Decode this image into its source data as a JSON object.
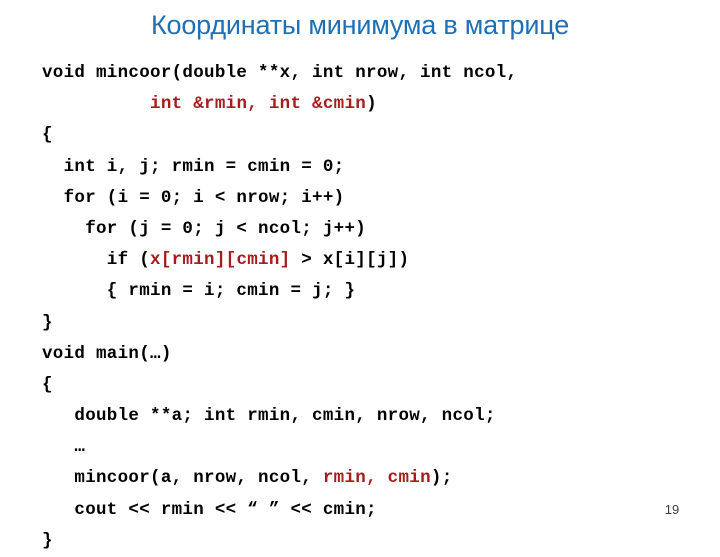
{
  "slide": {
    "title": "Координаты минимума в матрице",
    "number": "19",
    "title_color": "#1F6FB5",
    "code_highlight_color": "#A61C1C",
    "code_text_color": "#000000",
    "background_color": "#FFFFFF"
  },
  "code": {
    "lines": [
      {
        "id": "line-1",
        "segments": [
          {
            "text": "void mincoor(double **x, int nrow, int ncol,",
            "color": "black"
          }
        ]
      },
      {
        "id": "line-2",
        "segments": [
          {
            "text": "          ",
            "color": "black"
          },
          {
            "text": "int &rmin, int &cmin",
            "color": "red"
          },
          {
            "text": ")",
            "color": "black"
          }
        ]
      },
      {
        "id": "line-3",
        "segments": [
          {
            "text": "{",
            "color": "black"
          }
        ]
      },
      {
        "id": "line-4",
        "segments": [
          {
            "text": "  int i, j; rmin = cmin = 0;",
            "color": "black"
          }
        ]
      },
      {
        "id": "line-5",
        "segments": [
          {
            "text": "  for (i = 0; i < nrow; i++)",
            "color": "black"
          }
        ]
      },
      {
        "id": "line-6",
        "segments": [
          {
            "text": "    for (j = 0; j < ncol; j++)",
            "color": "black"
          }
        ]
      },
      {
        "id": "line-7",
        "segments": [
          {
            "text": "      if (",
            "color": "black"
          },
          {
            "text": "x[rmin][cmin]",
            "color": "red"
          },
          {
            "text": " > x[i][j])",
            "color": "black"
          }
        ]
      },
      {
        "id": "line-8",
        "segments": [
          {
            "text": "      { rmin = i; cmin = j; }",
            "color": "black"
          }
        ]
      },
      {
        "id": "line-9",
        "segments": [
          {
            "text": "}",
            "color": "black"
          }
        ]
      },
      {
        "id": "line-10",
        "segments": [
          {
            "text": "void main(…)",
            "color": "black"
          }
        ]
      },
      {
        "id": "line-11",
        "segments": [
          {
            "text": "{",
            "color": "black"
          }
        ]
      },
      {
        "id": "line-12",
        "segments": [
          {
            "text": "   double **a; int rmin, cmin, nrow, ncol;",
            "color": "black"
          }
        ]
      },
      {
        "id": "line-13",
        "segments": [
          {
            "text": "   …",
            "color": "black"
          }
        ]
      },
      {
        "id": "line-14",
        "segments": [
          {
            "text": "   mincoor(a, nrow, ncol, ",
            "color": "black"
          },
          {
            "text": "rmin, cmin",
            "color": "red"
          },
          {
            "text": ");",
            "color": "black"
          }
        ]
      },
      {
        "id": "line-15",
        "segments": [
          {
            "text": "   cout << rmin << “ ” << cmin;",
            "color": "black"
          }
        ]
      },
      {
        "id": "line-16",
        "segments": [
          {
            "text": "}",
            "color": "black"
          }
        ]
      }
    ]
  }
}
